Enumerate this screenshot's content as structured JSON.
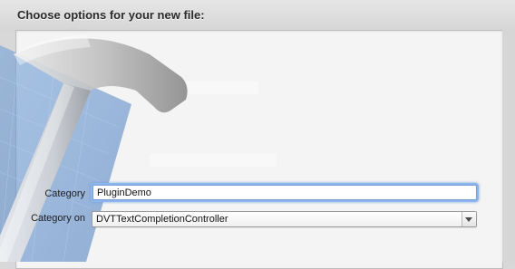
{
  "header": {
    "title": "Choose options for your new file:"
  },
  "form": {
    "category": {
      "label": "Category",
      "value": "PluginDemo"
    },
    "category_on": {
      "label": "Category on",
      "value": "DVTTextCompletionController"
    }
  },
  "icons": {
    "artwork": "hammer-blueprint-icon",
    "dropdown": "chevron-down-icon"
  },
  "colors": {
    "focus_ring": "#8cb5ef",
    "blueprint": "#4f84c4"
  }
}
